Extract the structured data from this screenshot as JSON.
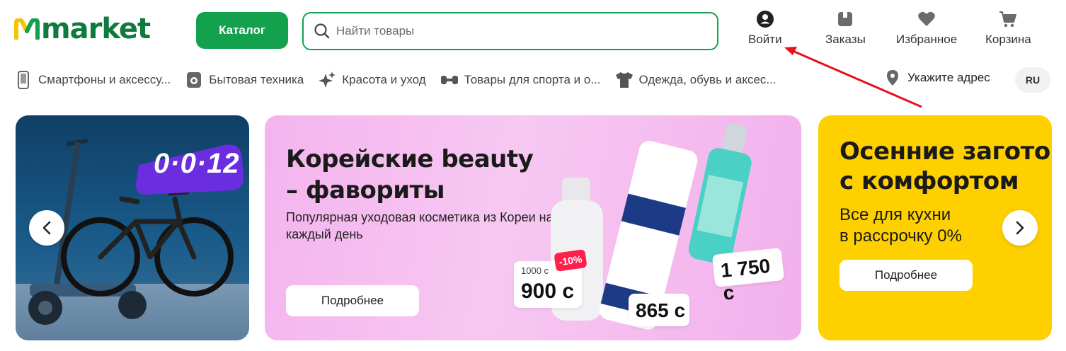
{
  "header": {
    "logo_text": "market",
    "catalog_label": "Каталог",
    "search": {
      "placeholder": "Найти товары"
    },
    "actions": [
      {
        "label": "Войти",
        "icon": "user-icon"
      },
      {
        "label": "Заказы",
        "icon": "orders-icon"
      },
      {
        "label": "Избранное",
        "icon": "heart-icon"
      },
      {
        "label": "Корзина",
        "icon": "cart-icon"
      }
    ]
  },
  "categories": [
    {
      "label": "Смартфоны и аксессу...",
      "icon": "smartphone-icon"
    },
    {
      "label": "Бытовая техника",
      "icon": "appliance-icon"
    },
    {
      "label": "Красота и уход",
      "icon": "sparkle-icon"
    },
    {
      "label": "Товары для спорта и о...",
      "icon": "dumbbell-icon"
    },
    {
      "label": "Одежда, обувь и аксес...",
      "icon": "tshirt-icon"
    }
  ],
  "address_label": "Укажите адрес",
  "language": "RU",
  "banners": {
    "left": {
      "timer": "0·0·12"
    },
    "center": {
      "title": "Корейские beauty – фавориты",
      "subtitle": "Популярная уходовая косметика из Кореи на каждый день",
      "button": "Подробнее",
      "prices": {
        "old": "1000 с",
        "new": "900 с",
        "discount": "-10%",
        "tube": "865 с",
        "bottle": "1 750 с"
      }
    },
    "right": {
      "title_line1": "Осенние заготов",
      "title_line2": "с комфортом",
      "subtitle_line1": "Все для кухни",
      "subtitle_line2": "в рассрочку 0%",
      "button": "Подробнее"
    }
  },
  "colors": {
    "brand_green": "#13a14e",
    "logo_green": "#0f7a3d",
    "logo_yellow": "#f3c400",
    "annotation_red": "#e8101c"
  }
}
